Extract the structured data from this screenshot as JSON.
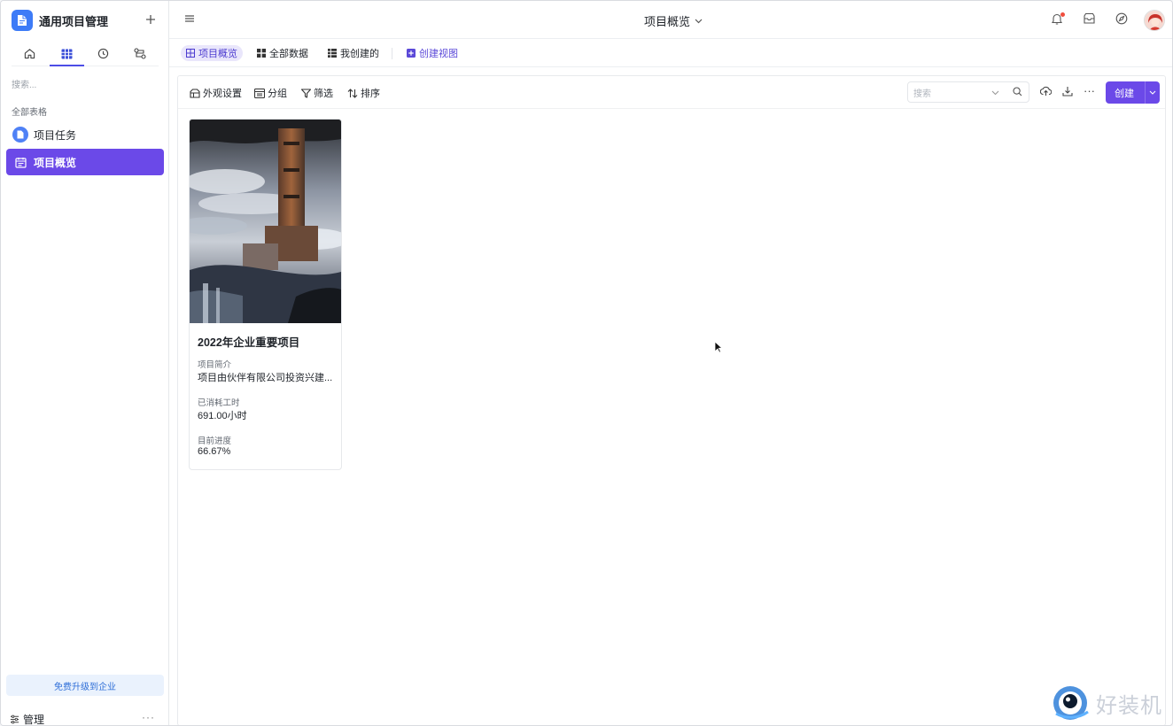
{
  "sidebar": {
    "app_title": "通用项目管理",
    "search_placeholder": "搜索...",
    "section_label": "全部表格",
    "items": [
      {
        "label": "项目任务",
        "icon": "document-icon"
      },
      {
        "label": "项目概览",
        "icon": "calendar-icon",
        "active": true
      }
    ],
    "upgrade_label": "免费升级到企业",
    "manage_label": "管理",
    "more_glyph": "···"
  },
  "topbar": {
    "page_title": "项目概览"
  },
  "view_tabs": [
    {
      "label": "项目概览",
      "icon": "grid-icon",
      "active": true
    },
    {
      "label": "全部数据",
      "icon": "grid-icon"
    },
    {
      "label": "我创建的",
      "icon": "list-icon"
    },
    {
      "label": "创建视图",
      "icon": "plus-square-icon"
    }
  ],
  "toolbar": {
    "appearance_label": "外观设置",
    "group_label": "分组",
    "filter_label": "筛选",
    "sort_label": "排序",
    "search_placeholder": "搜索",
    "create_label": "创建"
  },
  "card": {
    "title": "2022年企业重要项目",
    "fields": [
      {
        "label": "项目简介",
        "value": "项目由伙伴有限公司投资兴建..."
      },
      {
        "label": "已消耗工时",
        "value": "691.00小时"
      },
      {
        "label": "目前进度",
        "value": "66.67%"
      }
    ]
  },
  "watermark": "好装机",
  "colors": {
    "accent": "#6b49e8",
    "logo_blue": "#3d7bf7",
    "upgrade_bg": "#eaf2fd"
  }
}
